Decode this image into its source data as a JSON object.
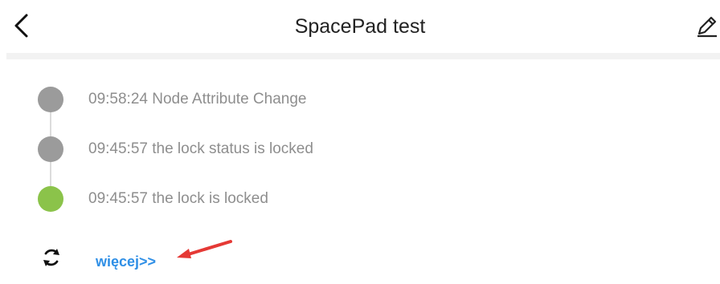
{
  "header": {
    "title": "SpacePad test",
    "back_icon": "chevron-left-icon",
    "edit_icon": "pencil-icon"
  },
  "events": [
    {
      "text": "09:58:24 Node Attribute Change",
      "dot_color": "#9b9b9b"
    },
    {
      "text": "09:45:57 the lock status is locked",
      "dot_color": "#9b9b9b"
    },
    {
      "text": "09:45:57 the lock is locked",
      "dot_color": "#8bc34a"
    }
  ],
  "footer": {
    "more_label": "więcej>>",
    "refresh_icon": "refresh-icon",
    "link_color": "#2f8fe6"
  },
  "annotation": {
    "arrow_color": "#e53935"
  }
}
